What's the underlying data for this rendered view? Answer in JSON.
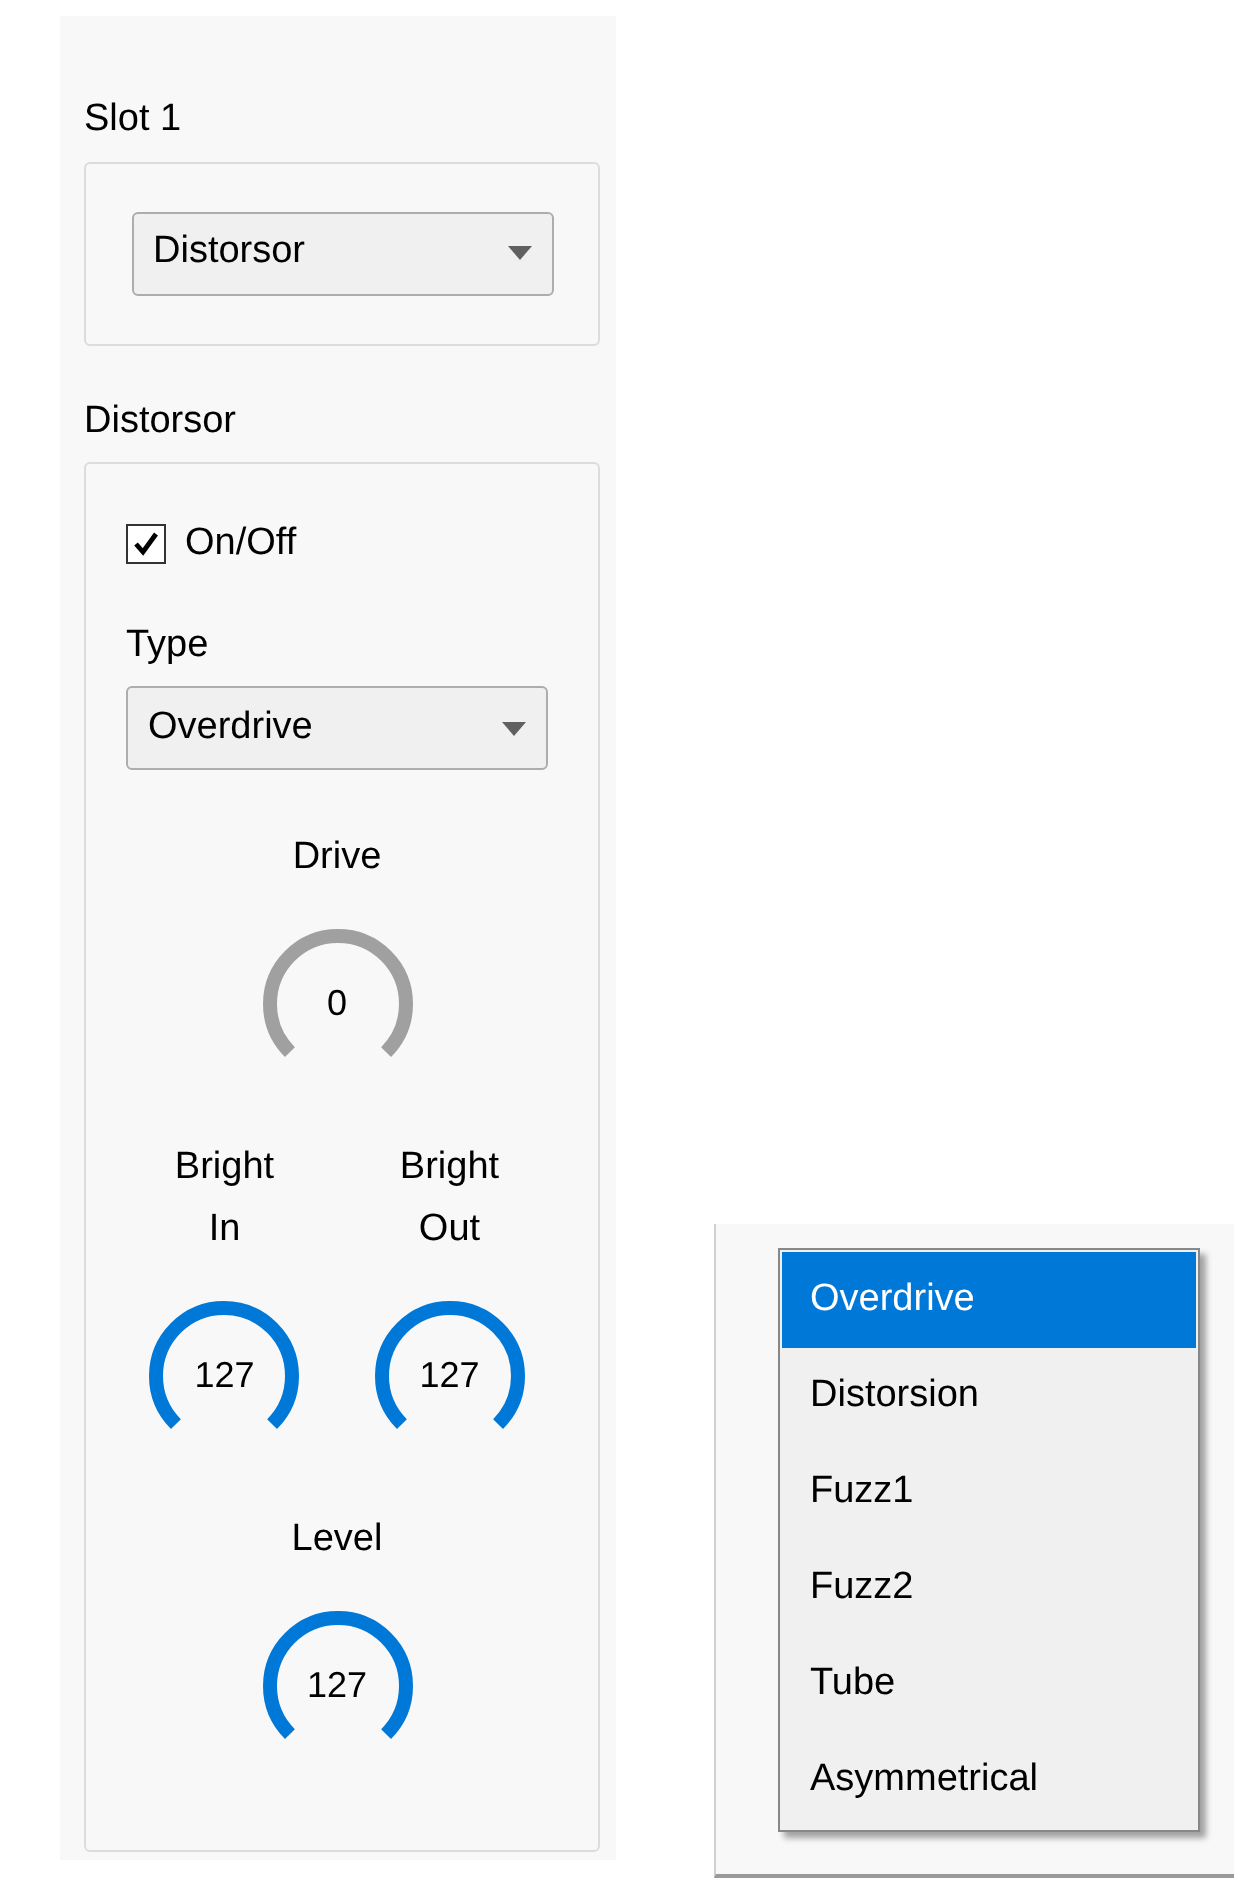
{
  "slot": {
    "title": "Slot 1",
    "combo": {
      "value": "Distorsor"
    }
  },
  "effect": {
    "title": "Distorsor",
    "power": {
      "label": "On/Off",
      "checked": true
    },
    "type": {
      "label": "Type",
      "value": "Overdrive"
    },
    "knob_rows": [
      {
        "knobs": [
          {
            "label": "Drive",
            "reading": "0",
            "highlighted": false
          }
        ]
      },
      {
        "knobs": [
          {
            "label": "Bright In",
            "reading": "127",
            "highlighted": true
          },
          {
            "label": "Bright Out",
            "reading": "127",
            "highlighted": true
          }
        ]
      },
      {
        "knobs": [
          {
            "label": "Level",
            "reading": "127",
            "highlighted": true
          }
        ]
      }
    ]
  },
  "type_dropdown": {
    "items": [
      {
        "label": "Overdrive",
        "selected": true
      },
      {
        "label": "Distorsion",
        "selected": false
      },
      {
        "label": "Fuzz1",
        "selected": false
      },
      {
        "label": "Fuzz2",
        "selected": false
      },
      {
        "label": "Tube",
        "selected": false
      },
      {
        "label": "Asymmetrical",
        "selected": false
      }
    ]
  }
}
